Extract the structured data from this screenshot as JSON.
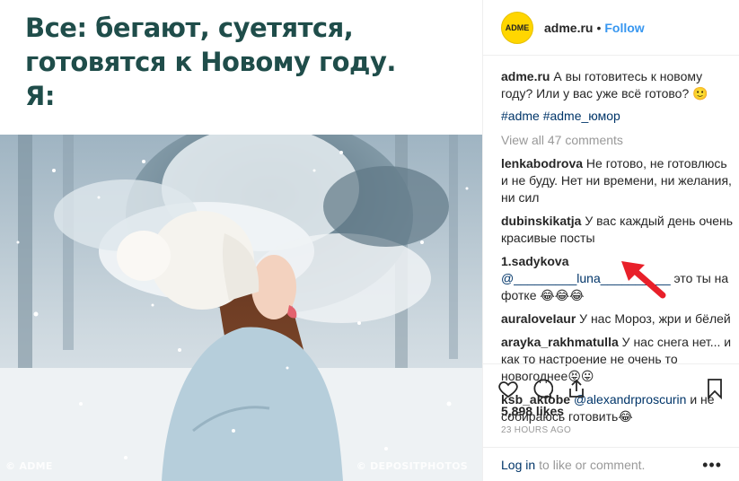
{
  "post": {
    "caption_lines": [
      "Все: бегают, суетятся,",
      "готовятся к Новому году.",
      "Я:"
    ],
    "watermark_left": "© ADME",
    "watermark_right": "© DEPOSITPHOTOS"
  },
  "header": {
    "avatar_text": "ADME",
    "username": "adme.ru",
    "separator": "•",
    "follow_label": "Follow"
  },
  "comments": {
    "author_caption": {
      "user": "adme.ru",
      "text": "А вы готовитесь к новому году? Или у вас уже всё готово? 🙂"
    },
    "tags": "#adme #adme_юмор",
    "view_all": "View all 47 comments",
    "items": [
      {
        "user": "lenkabodrova",
        "text": "Не готово, не готовлюсь и не буду. Нет ни времени, ни желания, ни сил"
      },
      {
        "user": "dubinskikatja",
        "text": "У вас каждый день очень красивые посты"
      },
      {
        "user": "1.sadykova",
        "mention": "@_________luna__________",
        "text": "это ты на фотке 😂😂😂"
      },
      {
        "user": "auraloveIaur",
        "text": "У нас Мороз, жри и бёлей"
      },
      {
        "user": "arayka_rakhmatulla",
        "text": "У нас снега нет... и как то настроение не очень то новогоднее😝😛"
      },
      {
        "user": "ksb_aktobe",
        "mention": "@alexandrproscurin",
        "text": "и не собираюсь готовить😂"
      }
    ]
  },
  "actions": {
    "like_icon": "heart-icon",
    "comment_icon": "comment-icon",
    "share_icon": "share-icon",
    "save_icon": "bookmark-icon",
    "likes": "5,898 likes",
    "time": "23 HOURS AGO",
    "login_label": "Log in",
    "login_suffix": "to like or comment.",
    "more": "•••"
  },
  "colors": {
    "accent": "#3897f0",
    "link": "#003569",
    "muted": "#999999",
    "caption_green": "#1f4d4a",
    "avatar_yellow": "#ffd600",
    "arrow_red": "#e8202a"
  }
}
